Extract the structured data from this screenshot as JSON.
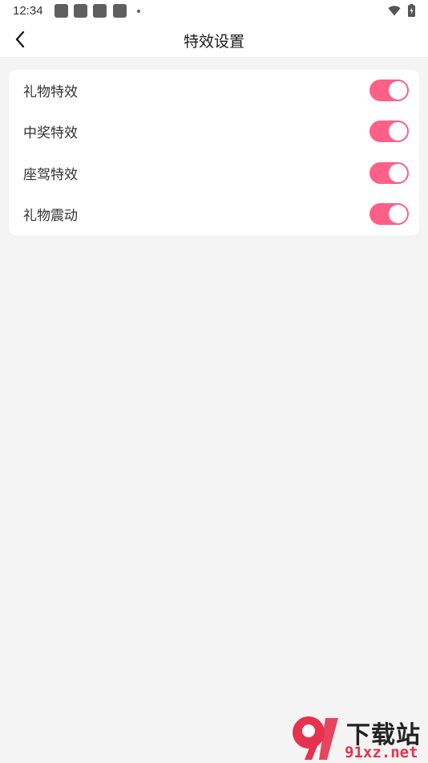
{
  "status_bar": {
    "time": "12:34"
  },
  "header": {
    "title": "特效设置"
  },
  "settings": [
    {
      "label": "礼物特效",
      "enabled": true
    },
    {
      "label": "中奖特效",
      "enabled": true
    },
    {
      "label": "座驾特效",
      "enabled": true
    },
    {
      "label": "礼物震动",
      "enabled": true
    }
  ],
  "colors": {
    "toggle_on": "#fe6088",
    "background": "#f4f4f4",
    "card": "#ffffff"
  },
  "watermark": {
    "logo_text": "9",
    "brand": "下载站",
    "domain": "91xz.net"
  }
}
